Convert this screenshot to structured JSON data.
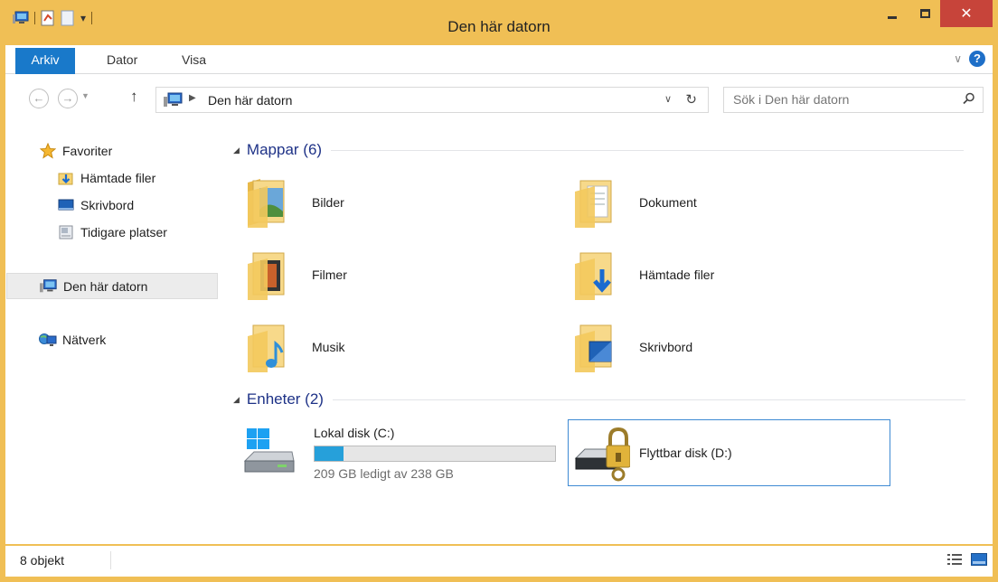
{
  "window": {
    "title": "Den här datorn",
    "close_glyph": "✕"
  },
  "ribbon": {
    "tabs": [
      "Arkiv",
      "Dator",
      "Visa"
    ],
    "help_glyph": "?"
  },
  "address": {
    "path": "Den här datorn"
  },
  "search": {
    "placeholder": "Sök i Den här datorn"
  },
  "navpane": {
    "favorites": "Favoriter",
    "favorite_items": [
      "Hämtade filer",
      "Skrivbord",
      "Tidigare platser"
    ],
    "this_pc": "Den här datorn",
    "network": "Nätverk"
  },
  "content": {
    "folders_header": "Mappar (6)",
    "folders": [
      "Bilder",
      "Dokument",
      "Filmer",
      "Hämtade filer",
      "Musik",
      "Skrivbord"
    ],
    "devices_header": "Enheter (2)",
    "drives": [
      {
        "name": "Lokal disk (C:)",
        "free_text": "209 GB ledigt av 238 GB",
        "used_fraction": 0.122
      },
      {
        "name": "Flyttbar disk (D:)"
      }
    ]
  },
  "status": {
    "count": "8 objekt"
  },
  "colors": {
    "frame": "#f0bf55",
    "accent": "#1979ca",
    "close": "#c7443a",
    "header": "#1e3287",
    "progress": "#26a0da",
    "selection": "#3e8ad3"
  }
}
